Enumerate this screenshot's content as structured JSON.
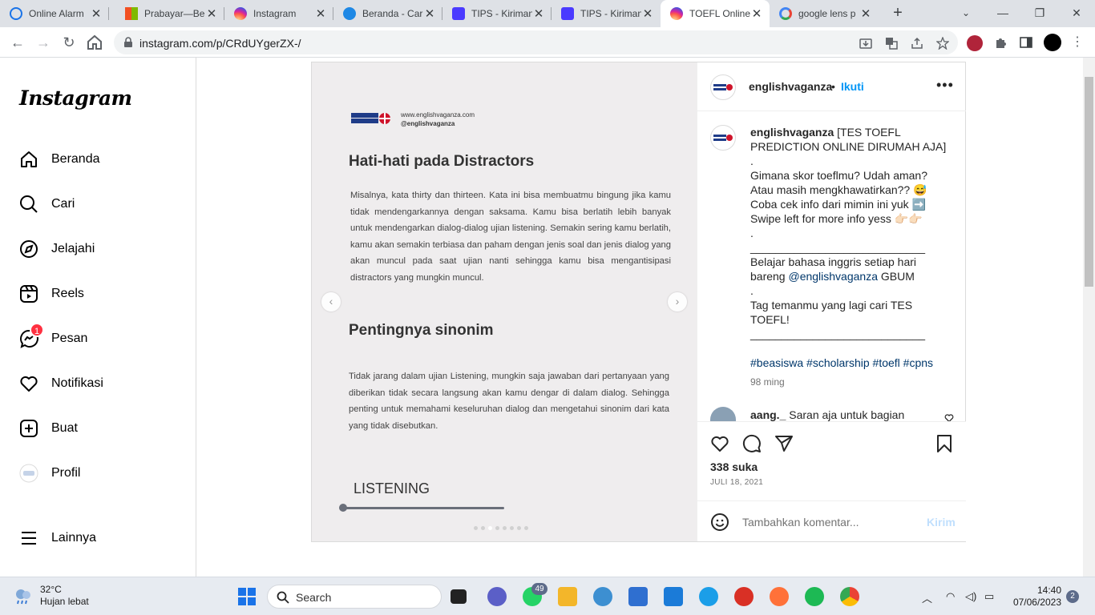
{
  "browser": {
    "tabs": [
      {
        "label": "Online Alarm",
        "color": "#1a73e8"
      },
      {
        "label": "Prabayar—Be",
        "color": "#f25022"
      },
      {
        "label": "Instagram",
        "color": "#d6249f"
      },
      {
        "label": "Beranda - Car",
        "color": "#1e88e5"
      },
      {
        "label": "TIPS - Kiriman",
        "color": "#4a3aff"
      },
      {
        "label": "TIPS - Kiriman",
        "color": "#4a3aff"
      },
      {
        "label": "TOEFL Online",
        "color": "#d6249f"
      },
      {
        "label": "google lens p",
        "color": "#4285f4"
      }
    ],
    "url": "instagram.com/p/CRdUYgerZX-/"
  },
  "sidebar": {
    "logo": "Instagram",
    "items": [
      {
        "label": "Beranda",
        "icon": "home-icon"
      },
      {
        "label": "Cari",
        "icon": "search-icon"
      },
      {
        "label": "Jelajahi",
        "icon": "compass-icon"
      },
      {
        "label": "Reels",
        "icon": "reels-icon"
      },
      {
        "label": "Pesan",
        "icon": "messenger-icon",
        "badge": "1"
      },
      {
        "label": "Notifikasi",
        "icon": "heart-icon"
      },
      {
        "label": "Buat",
        "icon": "plus-square-icon"
      },
      {
        "label": "Profil",
        "icon": "profile-avatar-icon"
      }
    ],
    "more": "Lainnya"
  },
  "media": {
    "brand_line1": "www.englishvaganza.com",
    "brand_line2": "@englishvaganza",
    "heading1": "Hati-hati pada Distractors",
    "paragraph1": "Misalnya, kata thirty dan thirteen. Kata ini bisa membuatmu bingung jika kamu tidak mendengarkannya dengan saksama. Kamu bisa berlatih lebih banyak untuk mendengarkan dialog-dialog ujian listening. Semakin sering kamu berlatih, kamu akan semakin terbiasa dan paham dengan jenis soal dan jenis dialog yang akan muncul pada saat ujian nanti sehingga kamu bisa mengantisipasi distractors yang mungkin muncul.",
    "heading2": "Pentingnya sinonim",
    "paragraph2": "Tidak jarang dalam ujian Listening, mungkin saja jawaban dari pertanyaan yang diberikan tidak secara langsung akan kamu dengar di dalam dialog. Sehingga penting untuk memahami keseluruhan dialog dan mengetahui sinonim dari kata yang tidak disebutkan.",
    "footer": "LISTENING",
    "prev": "‹",
    "next": "›"
  },
  "post": {
    "username": "englishvaganza",
    "dot": "•",
    "follow": "Ikuti",
    "more": "•••",
    "caption_user": "englishvaganza",
    "caption_text": " [TES TOEFL PREDICTION ONLINE DIRUMAH AJA]\n.\nGimana skor toeflmu? Udah aman? Atau masih mengkhawatirkan?? 😅\nCoba cek info dari mimin ini yuk ➡️\nSwipe left for more info yess 👉🏻👉🏻\n.\n____________________________\nBelajar bahasa inggris setiap hari bareng ",
    "caption_mention": "@englishvaganza",
    "caption_text2": " GBUM\n.\nTag temanmu yang lagi cari TES TOEFL!\n____________________________\n\n",
    "caption_tags": "#beasiswa #scholarship #toefl #cpns",
    "caption_time": "98 ming",
    "comment_user": "aang._",
    "comment_text": " Saran aja untuk bagian",
    "likes": "338 suka",
    "date": "JULI 18, 2021",
    "comment_placeholder": "Tambahkan komentar...",
    "send": "Kirim"
  },
  "taskbar": {
    "temp": "32°C",
    "weather": "Hujan lebat",
    "search": "Search",
    "whatsapp_badge": "49",
    "time": "14:40",
    "date": "07/06/2023",
    "notifications": "2"
  }
}
